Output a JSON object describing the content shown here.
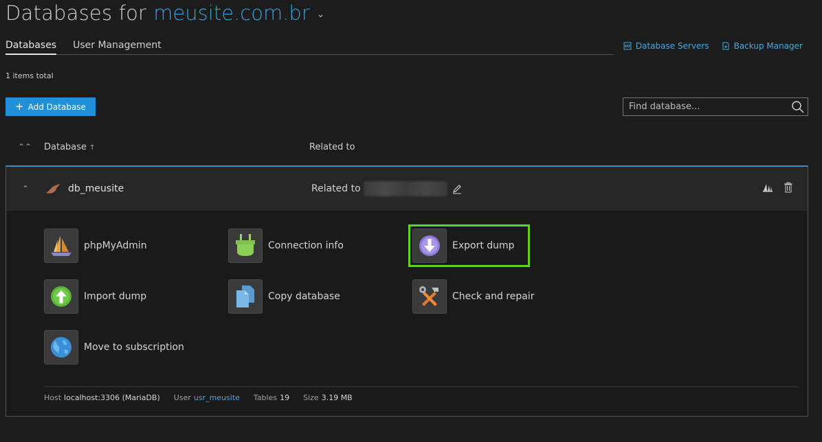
{
  "header": {
    "title_prefix": "Databases for",
    "domain": "meusite.com.br"
  },
  "tabs": [
    {
      "label": "Databases",
      "active": true
    },
    {
      "label": "User Management",
      "active": false
    }
  ],
  "top_links": {
    "database_servers": "Database Servers",
    "backup_manager": "Backup Manager"
  },
  "items_total": "1 items total",
  "add_button": "Add Database",
  "search": {
    "placeholder": "Find database..."
  },
  "columns": {
    "database": "Database",
    "related_to": "Related to"
  },
  "database": {
    "name": "db_meusite",
    "related_label": "Related to"
  },
  "tools": {
    "phpmyadmin": "phpMyAdmin",
    "connection_info": "Connection info",
    "export_dump": "Export dump",
    "import_dump": "Import dump",
    "copy_database": "Copy database",
    "check_repair": "Check and repair",
    "move_subscription": "Move to subscription"
  },
  "footer": {
    "host_label": "Host",
    "host_value": "localhost:3306 (MariaDB)",
    "user_label": "User",
    "user_value": "usr_meusite",
    "tables_label": "Tables",
    "tables_value": "19",
    "size_label": "Size",
    "size_value": "3.19 MB"
  },
  "colors": {
    "accent": "#1f8fd9",
    "highlight": "#5fd31f",
    "background": "#1c1c1c"
  }
}
